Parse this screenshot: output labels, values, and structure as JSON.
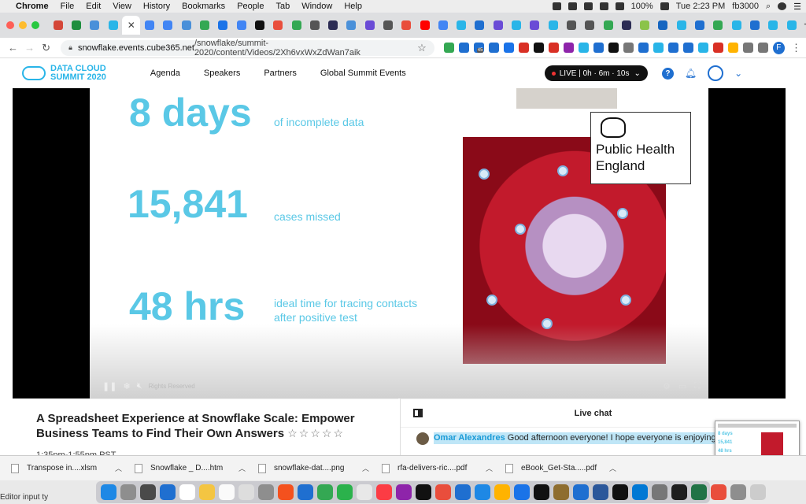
{
  "menubar": {
    "app": "Chrome",
    "items": [
      "File",
      "Edit",
      "View",
      "History",
      "Bookmarks",
      "People",
      "Tab",
      "Window",
      "Help"
    ],
    "battery": "100%",
    "clock": "Tue 2:23 PM",
    "user": "fb3000"
  },
  "tabs": {
    "favicon_colors": [
      "#d44638",
      "#1e8e3e",
      "#4a90d9",
      "#29b5e8",
      "#ffffff",
      "#4285f4",
      "#4285f4",
      "#4a90d9",
      "#34a853",
      "#1a73e8",
      "#4285f4",
      "#111111",
      "#e94e3c",
      "#34a853",
      "#555555",
      "#2c2c54",
      "#4a90d9",
      "#6a4bd6",
      "#555555",
      "#e94e3c",
      "#ff0000",
      "#4285f4",
      "#29b5e8",
      "#1f6fd0",
      "#6a4bd6",
      "#29b5e8",
      "#6a4bd6",
      "#29b5e8",
      "#555555",
      "#555555",
      "#34a853",
      "#2c2c54",
      "#8bc34a",
      "#1565c0",
      "#29b5e8",
      "#1f6fd0",
      "#34a853",
      "#29b5e8",
      "#1f6fd0",
      "#29b5e8",
      "#29b5e8"
    ],
    "active_close": "✕",
    "new_tab": "+"
  },
  "toolbar": {
    "url_host": "snowflake.events.cube365.net",
    "url_path": "/snowflake/summit-2020/content/Videos/2Xh6vxWxZdWan7aik",
    "extension_colors": [
      "#34a853",
      "#1f6fd0",
      "#1f6fd0",
      "#1f6fd0",
      "#1a73e8",
      "#d93025",
      "#111111",
      "#d93025",
      "#8e24aa",
      "#29b5e8",
      "#1f6fd0",
      "#111111",
      "#777777",
      "#1f6fd0",
      "#29b5e8",
      "#1f6fd0",
      "#1f6fd0",
      "#29b5e8",
      "#d93025",
      "#ffb300",
      "#777777",
      "#777777"
    ],
    "profile_initial": "F",
    "ext_badge": "45"
  },
  "site": {
    "logo_line1": "DATA CLOUD",
    "logo_line2": "SUMMIT 2020",
    "nav": [
      "Agenda",
      "Speakers",
      "Partners",
      "Global Summit Events"
    ],
    "live_label": "LIVE | 0h · 6m · 10s",
    "live_chevron": "⌄",
    "help": "?",
    "accent": "#29b5e8"
  },
  "video": {
    "stats": [
      {
        "value": "8 days",
        "label": "of incomplete data"
      },
      {
        "value": "15,841",
        "label": "cases missed"
      },
      {
        "value": "48 hrs",
        "label": "ideal time for tracing contacts after positive test"
      }
    ],
    "logo_box": "Public Health England",
    "watermark": "Rights Reserved",
    "stat_color": "#5ac8e6"
  },
  "session": {
    "title": "A Spreadsheet Experience at Snowflake Scale: Empower Business Teams to Find Their Own Answers",
    "rating_stars": "☆☆☆☆☆",
    "time": "1:35pm-1:55pm PST"
  },
  "chat": {
    "heading": "Live chat",
    "messages": [
      {
        "name": "Omar Alexandres",
        "text": "Good afternoon everyone! I hope everyone is enjoying tod"
      }
    ]
  },
  "pip": {
    "stats": [
      "8 days",
      "15,841",
      "48 hrs"
    ]
  },
  "downloads": {
    "files": [
      "Transpose in....xlsm",
      "Snowflake _ D....htm",
      "snowflake-dat....png",
      "rfa-delivers-ric....pdf",
      "eBook_Get-Sta.....pdf"
    ]
  },
  "status_bar": "Editor input ty",
  "dock": {
    "icon_colors": [
      "#1e88e5",
      "#8e8e8e",
      "#4a4a4a",
      "#1f6fd0",
      "#ffffff",
      "#f4c542",
      "#fafafa",
      "#dddddd",
      "#8e8e8e",
      "#f4511e",
      "#1f6fd0",
      "#34a853",
      "#2bb24c",
      "#e8e8e8",
      "#fc3c44",
      "#8e24aa",
      "#111111",
      "#e94e3c",
      "#1f6fd0",
      "#1e88e5",
      "#ffb300",
      "#1a73e8",
      "#111111",
      "#8e6d2f",
      "#1f6fd0",
      "#2b579a",
      "#111111",
      "#0078d4",
      "#777777",
      "#1e1e1e",
      "#217346",
      "#e94e3c",
      "#8e8e8e",
      "#cccccc"
    ]
  }
}
